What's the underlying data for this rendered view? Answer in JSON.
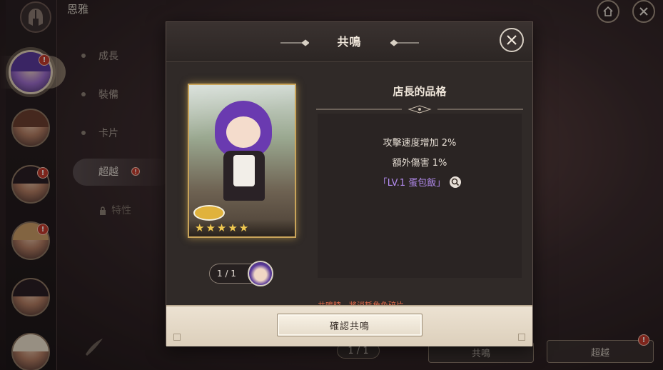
{
  "background": {
    "character_name": "恩雅",
    "menu": [
      {
        "label": "成長"
      },
      {
        "label": "裝備"
      },
      {
        "label": "卡片"
      },
      {
        "label": "超越"
      },
      {
        "label": "特性"
      }
    ],
    "bottom": {
      "count": "1 / 1",
      "resonance_button": "共鳴",
      "transcend_button": "超越",
      "alert": "!"
    },
    "alert_mark": "!"
  },
  "modal": {
    "title": "共鳴",
    "card": {
      "count": "1 / 1",
      "stars": 5,
      "star_glyph": "★"
    },
    "skill": {
      "name": "店長的品格",
      "effects": [
        "攻擊速度增加 2%",
        "額外傷害 1%"
      ],
      "linked_item": "「LV.1 蛋包飯」"
    },
    "warning": "共鳴時，將消耗角色碎片。",
    "confirm_button": "確認共鳴"
  },
  "colors": {
    "accent_gold": "#c9a45a",
    "link_purple": "#b48cf0",
    "warning_red": "#e06a4a",
    "alert_red": "#c0392b"
  },
  "icons": [
    "helmet-icon",
    "home-icon",
    "close-icon",
    "lock-icon",
    "magnifier-icon",
    "feather-icon"
  ]
}
